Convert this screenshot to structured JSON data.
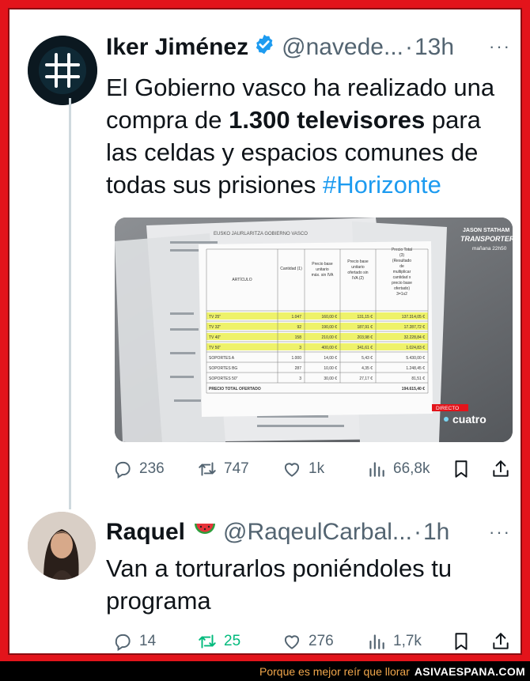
{
  "tweet1": {
    "name": "Iker Jiménez",
    "handle": "@navede...",
    "dot": "·",
    "time": "13h",
    "text_parts": {
      "a": "El Gobierno vasco ha realizado una compra de ",
      "bold": "1.300 televisores",
      "b": " para las celdas y espacios comunes de todas sus prisiones ",
      "hashtag": "#Horizonte"
    },
    "media": {
      "doc_headers": {
        "articulo": "ARTÍCULO",
        "cantidad": "Cantidad (1)",
        "precio_max": "Precio base unitario máx. sin IVA",
        "precio_ofert": "Precio base unitario ofertado sin IVA (2)",
        "precio_total": "Precio Total (3) (Resultado de multiplicar cantidad x precio base ofertado) 3=1x2"
      },
      "rows": [
        {
          "item": "TV 25\"",
          "qty": "1.047",
          "max": "160,00 €",
          "offer": "131,15 €",
          "total": "137.314,05 €",
          "highlight": true
        },
        {
          "item": "TV 32\"",
          "qty": "92",
          "max": "190,00 €",
          "offer": "187,91 €",
          "total": "17.287,72 €",
          "highlight": true
        },
        {
          "item": "TV 40\"",
          "qty": "158",
          "max": "210,00 €",
          "offer": "203,98 €",
          "total": "32.228,84 €",
          "highlight": true
        },
        {
          "item": "TV 50\"",
          "qty": "3",
          "max": "400,00 €",
          "offer": "341,61 €",
          "total": "1.024,83 €",
          "highlight": true
        },
        {
          "item": "SOPORTES A",
          "qty": "1.000",
          "max": "14,00 €",
          "offer": "5,43 €",
          "total": "5.430,00 €",
          "highlight": false
        },
        {
          "item": "SOPORTES BG",
          "qty": "287",
          "max": "10,00 €",
          "offer": "4,35 €",
          "total": "1.248,45 €",
          "highlight": false
        },
        {
          "item": "SOPORTES 50\"",
          "qty": "3",
          "max": "30,00 €",
          "offer": "27,17 €",
          "total": "81,51 €",
          "highlight": false
        }
      ],
      "total_label": "PRECIO TOTAL OFERTADO",
      "total_value": "194.615,40 €",
      "doc_letterhead": "EUSKO JAURLARITZA   GOBIERNO VASCO",
      "promo_line1": "JASON STATHAM",
      "promo_line2": "TRANSPORTER",
      "promo_line3": "mañana 22h50",
      "live_label": "DIRECTO",
      "channel": "cuatro"
    },
    "actions": {
      "replies": "236",
      "retweets": "747",
      "likes": "1k",
      "views": "66,8k"
    }
  },
  "tweet2": {
    "name": "Raquel",
    "handle": "@RaqeulCarbal...",
    "dot": "·",
    "time": "1h",
    "text": "Van a torturarlos poniéndoles tu programa",
    "actions": {
      "replies": "14",
      "retweets": "25",
      "likes": "276",
      "views": "1,7k"
    }
  },
  "footer": {
    "slogan": "Porque es mejor reír que llorar",
    "site": "ASIVAESPANA.COM"
  },
  "colors": {
    "frame": "#e3141b",
    "link": "#1d9bf0",
    "retweet_active": "#00ba7c",
    "muted": "#536471",
    "verified": "#1d9bf0",
    "highlight_row": "#eef26a"
  }
}
